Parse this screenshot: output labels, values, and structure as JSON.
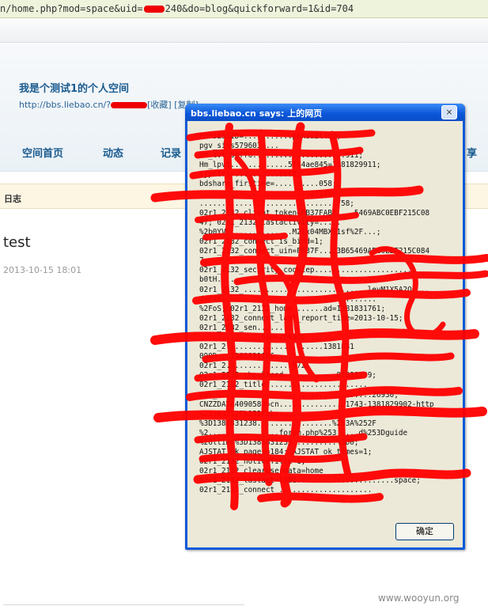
{
  "address_bar": {
    "url_start": "n/home.php?mod=space&uid=",
    "url_end": "240&do=blog&quickforward=1&id=704"
  },
  "header": {
    "space_title": "我是个测试1的个人空间",
    "space_url_prefix": "http://bbs.liebao.cn/?",
    "favorite_link": "[收藏]",
    "copy_link": "[复制]"
  },
  "nav": {
    "items": [
      "空间首页",
      "动态",
      "记录",
      "享"
    ]
  },
  "section": {
    "label": "日志"
  },
  "post": {
    "title": "test",
    "date": "2013-10-15 18:01"
  },
  "dialog": {
    "title": "bbs.liebao.cn says: 上的网页",
    "close_label": "×",
    "message_lines": [
      "PHPSESSID=...........pbksu2t4m2;",
      "pgv_si=s579603....",
      "Hm_lvt_5aff6.....................911;",
      "Hm_lpvt.............5f64ae845=1381829911;",
      "tjpctrl=..........8668;",
      "bdshare_firstime=..........058;",
      ".........................27148;",
      "...............................758;",
      "02r1_2132_client_token=FB37FAB7....5469ABC0EBF215C08",
      "47; 02r1_2132_lastactivity=.....",
      "%2b0YV...............M2lx04MBX51sf%2F...;",
      "02r1_2132_connect_is_bind=1;",
      "02r1_2132_connect_uin=FB37F....3B65469ABC0EBF215C084",
      "7;",
      "02r1_2132_security_cookiep.......................",
      "b0tH.......................................",
      "02r1_2132_............................leyM1X5A2O....",
      "dyFXk...................................",
      "%2FoS; 02r1_2132_home.......ad=1381831761;",
      "02r1_2132_connect_last_report_time=2013-10-15;",
      "02r1_2132_sen........",
      "..............69D62D65D5......",
      "02r1_2......................1381831",
      "090D_..1381831186................",
      "02r1_2...............972;",
      "02r1_2132_checkfeed............81831239;",
      "02r1_2132_title.......................",
      "pgv_...................................26930;",
      "CNZZDATA4090589=cn...............1743-1381829902-http",
      "%253A%252F%252Fbbs.........",
      "%3D1381831238.................%253A%252F",
      "%2................forum.php%253.....d%253Dguide",
      "%26ltime%3D1381831233..........%3D0;",
      "AJSTAT_ok_pages=184; AJSTAT_ok_times=1;",
      "02r1_2132_noticeTitle=1;",
      "02r1_2132_clearUserdata=home",
      "02r1_2132_lastact-1381......................space;",
      "02r1_2132_connect_....................."
    ],
    "ok_label": "确定"
  },
  "watermark": "www.wooyun.org"
}
